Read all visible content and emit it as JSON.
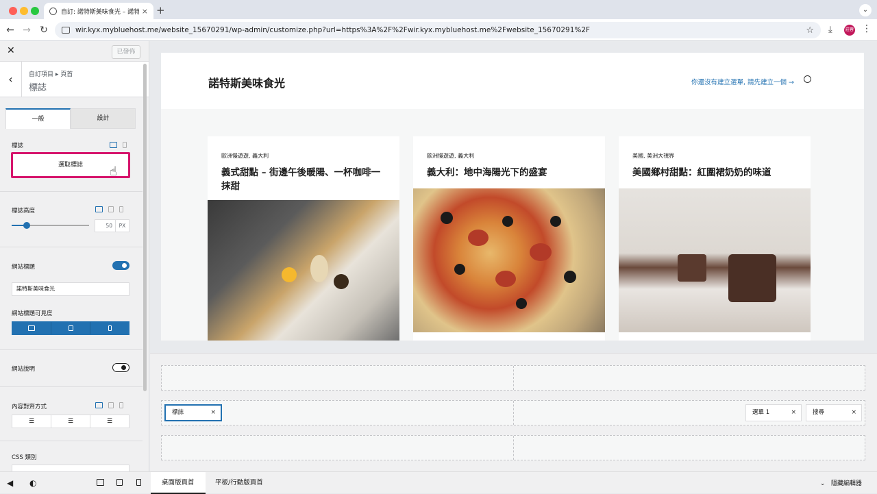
{
  "browser": {
    "tab_title": "自訂: 諾特斯美味食光 – 諾特斯",
    "url": "wir.kyx.mybluehost.me/website_15670291/wp-admin/customize.php?url=https%3A%2F%2Fwir.kyx.mybluehost.me%2Fwebsite_15670291%2F",
    "profile_initials": "莊蓉"
  },
  "sidebar": {
    "published_label": "已發佈",
    "breadcrumb": "自訂項目 ▸ 頁首",
    "title": "標誌",
    "tabs": [
      "一般",
      "設計"
    ],
    "logo_label": "標誌",
    "select_logo_button": "選取標誌",
    "logo_height_label": "標誌高度",
    "logo_height_value": "50",
    "logo_height_unit": "PX",
    "site_title_label": "網站標題",
    "site_title_value": "諾特斯美味食光",
    "site_title_visibility_label": "網站標題可見度",
    "site_tagline_label": "網站說明",
    "alignment_label": "內容對齊方式",
    "css_class_label": "CSS 類別"
  },
  "site": {
    "title": "諾特斯美味食光",
    "menu_notice": "你還沒有建立選單, 請先建立一個 →",
    "posts": [
      {
        "category": "歐洲慢遊遊, 義大利",
        "title": "義式甜點 – 街邊午後暖陽、一杯咖啡一抹甜"
      },
      {
        "category": "歐洲慢遊遊, 義大利",
        "title": "義大利：地中海陽光下的盛宴"
      },
      {
        "category": "美國, 美洲大視界",
        "title": "美國鄉村甜點：紅圍裙奶奶的味道"
      }
    ]
  },
  "builder": {
    "logo_chip": "標誌",
    "menu_chip": "選單 1",
    "search_chip": "搜尋",
    "remove_symbol": "×"
  },
  "footer": {
    "tabs": [
      "桌面版頁首",
      "平板/行動版頁首"
    ],
    "hide_editor": "隱藏編輯器"
  },
  "colors": {
    "accent": "#2271b1",
    "highlight": "#d6156c"
  }
}
